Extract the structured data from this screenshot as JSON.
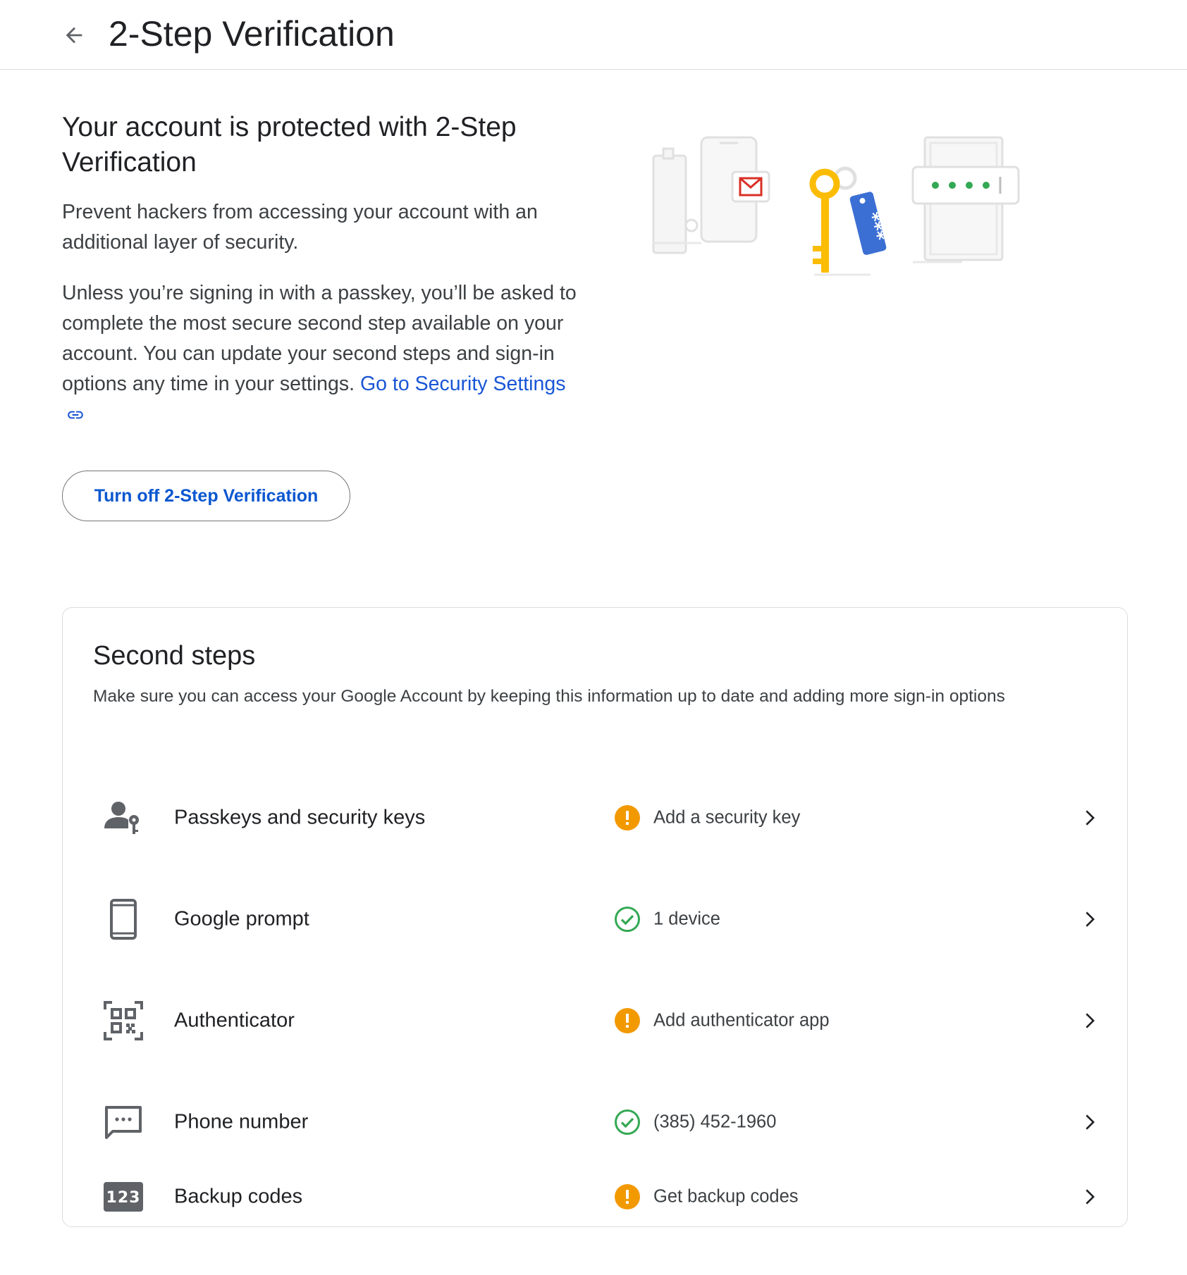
{
  "header": {
    "title": "2-Step Verification"
  },
  "intro": {
    "heading": "Your account is protected with 2-Step Verification",
    "paragraph1": "Prevent hackers from accessing your account with an additional layer of security.",
    "paragraph2": "Unless you’re signing in with a passkey, you’ll be asked to complete the most secure second step available on your account. You can update your second steps and sign-in options any time in your settings.",
    "security_link": "Go to Security Settings",
    "turn_off_button": "Turn off 2-Step Verification"
  },
  "second_steps": {
    "title": "Second steps",
    "subtitle": "Make sure you can access your Google Account by keeping this information up to date and adding more sign-in options",
    "items": [
      {
        "label": "Passkeys and security keys",
        "status": "Add a security key",
        "state": "warning",
        "icon": "passkey-person-icon"
      },
      {
        "label": "Google prompt",
        "status": "1 device",
        "state": "ok",
        "icon": "phone-device-icon"
      },
      {
        "label": "Authenticator",
        "status": "Add authenticator app",
        "state": "warning",
        "icon": "qr-code-icon"
      },
      {
        "label": "Phone number",
        "status": "(385) 452-1960",
        "state": "ok",
        "icon": "sms-message-icon"
      },
      {
        "label": "Backup codes",
        "status": "Get backup codes",
        "state": "warning",
        "icon": "backup-codes-icon"
      }
    ]
  },
  "colors": {
    "link": "#1a56d6",
    "warning": "#f29900",
    "success": "#34a853",
    "key_yellow": "#fbbc04",
    "tag_blue": "#4285f4",
    "mail_red": "#d93025",
    "dots_green": "#34a853"
  },
  "illustration_text": {
    "tag_code": "***"
  }
}
